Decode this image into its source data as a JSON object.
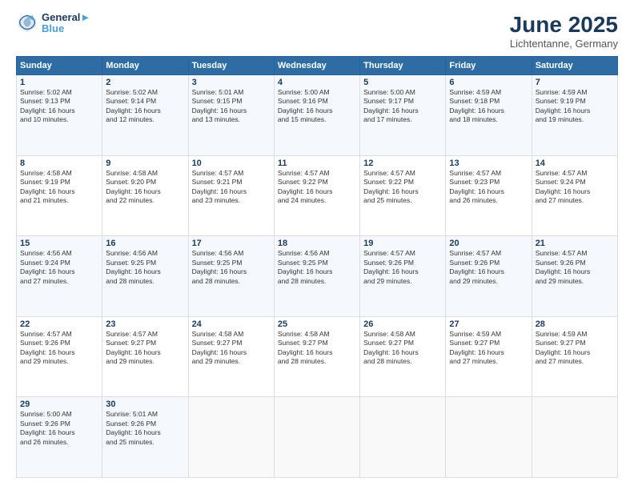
{
  "header": {
    "logo_line1": "General",
    "logo_line2": "Blue",
    "month": "June 2025",
    "location": "Lichtentanne, Germany"
  },
  "weekdays": [
    "Sunday",
    "Monday",
    "Tuesday",
    "Wednesday",
    "Thursday",
    "Friday",
    "Saturday"
  ],
  "weeks": [
    [
      {
        "day": "1",
        "info": "Sunrise: 5:02 AM\nSunset: 9:13 PM\nDaylight: 16 hours\nand 10 minutes."
      },
      {
        "day": "2",
        "info": "Sunrise: 5:02 AM\nSunset: 9:14 PM\nDaylight: 16 hours\nand 12 minutes."
      },
      {
        "day": "3",
        "info": "Sunrise: 5:01 AM\nSunset: 9:15 PM\nDaylight: 16 hours\nand 13 minutes."
      },
      {
        "day": "4",
        "info": "Sunrise: 5:00 AM\nSunset: 9:16 PM\nDaylight: 16 hours\nand 15 minutes."
      },
      {
        "day": "5",
        "info": "Sunrise: 5:00 AM\nSunset: 9:17 PM\nDaylight: 16 hours\nand 17 minutes."
      },
      {
        "day": "6",
        "info": "Sunrise: 4:59 AM\nSunset: 9:18 PM\nDaylight: 16 hours\nand 18 minutes."
      },
      {
        "day": "7",
        "info": "Sunrise: 4:59 AM\nSunset: 9:19 PM\nDaylight: 16 hours\nand 19 minutes."
      }
    ],
    [
      {
        "day": "8",
        "info": "Sunrise: 4:58 AM\nSunset: 9:19 PM\nDaylight: 16 hours\nand 21 minutes."
      },
      {
        "day": "9",
        "info": "Sunrise: 4:58 AM\nSunset: 9:20 PM\nDaylight: 16 hours\nand 22 minutes."
      },
      {
        "day": "10",
        "info": "Sunrise: 4:57 AM\nSunset: 9:21 PM\nDaylight: 16 hours\nand 23 minutes."
      },
      {
        "day": "11",
        "info": "Sunrise: 4:57 AM\nSunset: 9:22 PM\nDaylight: 16 hours\nand 24 minutes."
      },
      {
        "day": "12",
        "info": "Sunrise: 4:57 AM\nSunset: 9:22 PM\nDaylight: 16 hours\nand 25 minutes."
      },
      {
        "day": "13",
        "info": "Sunrise: 4:57 AM\nSunset: 9:23 PM\nDaylight: 16 hours\nand 26 minutes."
      },
      {
        "day": "14",
        "info": "Sunrise: 4:57 AM\nSunset: 9:24 PM\nDaylight: 16 hours\nand 27 minutes."
      }
    ],
    [
      {
        "day": "15",
        "info": "Sunrise: 4:56 AM\nSunset: 9:24 PM\nDaylight: 16 hours\nand 27 minutes."
      },
      {
        "day": "16",
        "info": "Sunrise: 4:56 AM\nSunset: 9:25 PM\nDaylight: 16 hours\nand 28 minutes."
      },
      {
        "day": "17",
        "info": "Sunrise: 4:56 AM\nSunset: 9:25 PM\nDaylight: 16 hours\nand 28 minutes."
      },
      {
        "day": "18",
        "info": "Sunrise: 4:56 AM\nSunset: 9:25 PM\nDaylight: 16 hours\nand 28 minutes."
      },
      {
        "day": "19",
        "info": "Sunrise: 4:57 AM\nSunset: 9:26 PM\nDaylight: 16 hours\nand 29 minutes."
      },
      {
        "day": "20",
        "info": "Sunrise: 4:57 AM\nSunset: 9:26 PM\nDaylight: 16 hours\nand 29 minutes."
      },
      {
        "day": "21",
        "info": "Sunrise: 4:57 AM\nSunset: 9:26 PM\nDaylight: 16 hours\nand 29 minutes."
      }
    ],
    [
      {
        "day": "22",
        "info": "Sunrise: 4:57 AM\nSunset: 9:26 PM\nDaylight: 16 hours\nand 29 minutes."
      },
      {
        "day": "23",
        "info": "Sunrise: 4:57 AM\nSunset: 9:27 PM\nDaylight: 16 hours\nand 29 minutes."
      },
      {
        "day": "24",
        "info": "Sunrise: 4:58 AM\nSunset: 9:27 PM\nDaylight: 16 hours\nand 29 minutes."
      },
      {
        "day": "25",
        "info": "Sunrise: 4:58 AM\nSunset: 9:27 PM\nDaylight: 16 hours\nand 28 minutes."
      },
      {
        "day": "26",
        "info": "Sunrise: 4:58 AM\nSunset: 9:27 PM\nDaylight: 16 hours\nand 28 minutes."
      },
      {
        "day": "27",
        "info": "Sunrise: 4:59 AM\nSunset: 9:27 PM\nDaylight: 16 hours\nand 27 minutes."
      },
      {
        "day": "28",
        "info": "Sunrise: 4:59 AM\nSunset: 9:27 PM\nDaylight: 16 hours\nand 27 minutes."
      }
    ],
    [
      {
        "day": "29",
        "info": "Sunrise: 5:00 AM\nSunset: 9:26 PM\nDaylight: 16 hours\nand 26 minutes."
      },
      {
        "day": "30",
        "info": "Sunrise: 5:01 AM\nSunset: 9:26 PM\nDaylight: 16 hours\nand 25 minutes."
      },
      null,
      null,
      null,
      null,
      null
    ]
  ]
}
